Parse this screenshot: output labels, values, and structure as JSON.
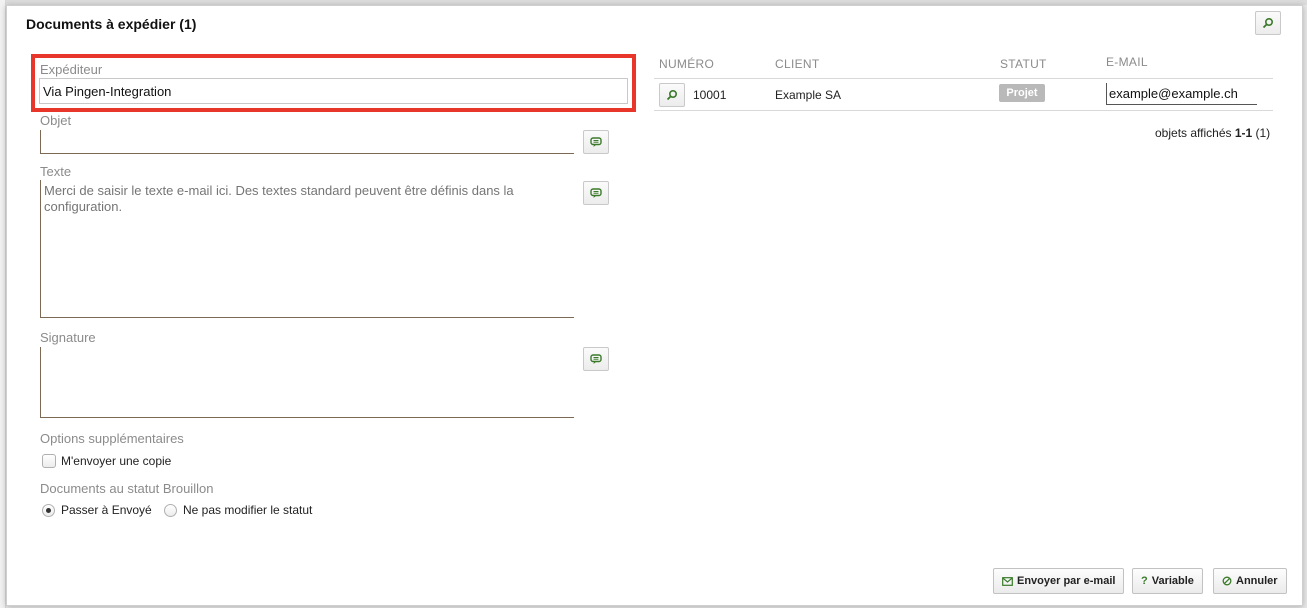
{
  "dialog": {
    "title": "Documents à expédier (1)"
  },
  "form": {
    "sender_label": "Expéditeur",
    "sender_value": "Via Pingen-Integration",
    "subject_label": "Objet",
    "subject_value": "",
    "text_label": "Texte",
    "text_placeholder": "Merci de saisir le texte e-mail ici. Des textes standard peuvent être définis dans la configuration.",
    "signature_label": "Signature",
    "signature_value": "",
    "options_label": "Options supplémentaires",
    "send_copy_label": "M'envoyer une copie",
    "send_copy_checked": false,
    "draft_label": "Documents au statut Brouillon",
    "draft_options": [
      {
        "label": "Passer à Envoyé",
        "selected": true
      },
      {
        "label": "Ne pas modifier le statut",
        "selected": false
      }
    ]
  },
  "table": {
    "headers": [
      "NUMÉRO",
      "CLIENT",
      "STATUT",
      "E-MAIL"
    ],
    "rows": [
      {
        "number": "10001",
        "client": "Example SA",
        "status": "Projet",
        "email": "example@example.ch"
      }
    ],
    "count_prefix": "objets affichés ",
    "count_range": "1-1",
    "count_total": " (1)"
  },
  "buttons": {
    "send_email": "Envoyer par e-mail",
    "variable": "Variable",
    "cancel": "Annuler"
  },
  "icons": {
    "search": "search-icon",
    "comment": "comment-icon",
    "envelope": "envelope-icon",
    "question": "question-icon",
    "cancel": "cancel-icon"
  },
  "colors": {
    "highlight": "#e8372a",
    "icon_green": "#3a7a2a",
    "status_badge": "#b9b9b9"
  }
}
